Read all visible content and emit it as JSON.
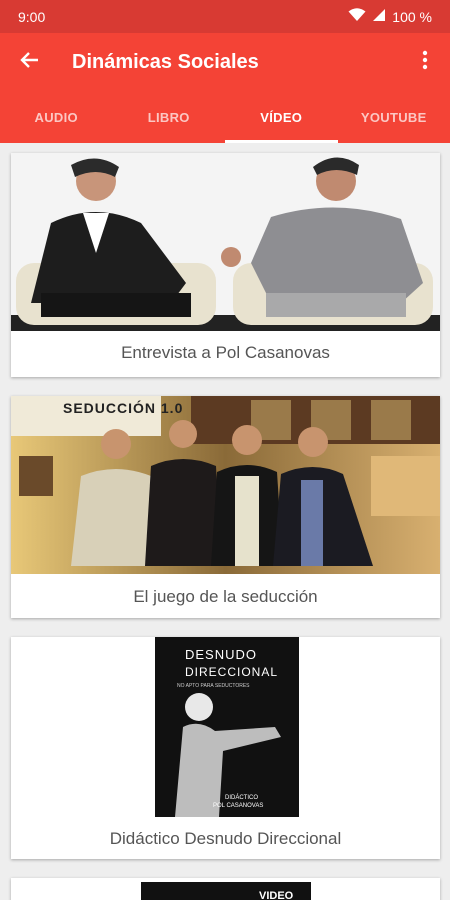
{
  "status": {
    "time": "9:00",
    "battery": "100 %"
  },
  "appbar": {
    "title": "Dinámicas Sociales"
  },
  "tabs": [
    {
      "label": "AUDIO",
      "active": false
    },
    {
      "label": "LIBRO",
      "active": false
    },
    {
      "label": "VÍDEO",
      "active": true
    },
    {
      "label": "YOUTUBE",
      "active": false
    }
  ],
  "videos": [
    {
      "caption": "Entrevista a Pol Casanovas"
    },
    {
      "caption": "El juego de la seducción",
      "poster_text": "SEDUCCIÓN 1.0"
    },
    {
      "caption": "Didáctico Desnudo Direccional",
      "poster_title_1": "DESNUDO",
      "poster_title_2": "DIRECCIONAL",
      "poster_sub": "NO APTO PARA SEDUCTORES",
      "poster_foot_1": "DIDÁCTICO",
      "poster_foot_2": "POL CASANOVAS"
    },
    {
      "poster_text": "VIDEO"
    }
  ]
}
